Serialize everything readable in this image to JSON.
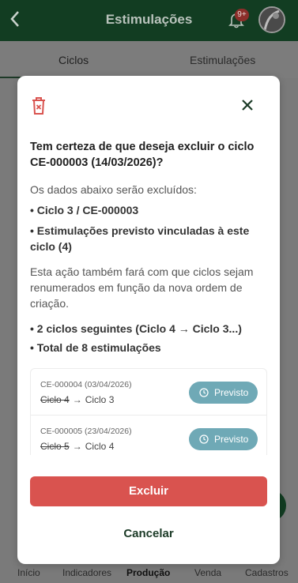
{
  "header": {
    "back_icon": "chevron-left-icon",
    "title": "Estimulações",
    "notification_badge": "9+",
    "bell_icon": "bell-icon"
  },
  "tabs": [
    {
      "label": "Ciclos",
      "active": true
    },
    {
      "label": "Estimulações",
      "active": false
    }
  ],
  "bottom_nav": [
    {
      "label": "Início"
    },
    {
      "label": "Indicadores"
    },
    {
      "label": "Produção",
      "active": true
    },
    {
      "label": "Venda"
    },
    {
      "label": "Cadastros"
    }
  ],
  "modal": {
    "trash_icon": "trash-icon",
    "close_icon": "close-icon",
    "heading": "Tem certeza de que deseja excluir o ciclo CE-000003 (14/03/2026)?",
    "intro": "Os dados abaixo serão excluídos:",
    "bullet_cycle": "• Ciclo 3 / CE-000003",
    "bullet_stims": "• Estimulações previsto vinculadas à este ciclo (4)",
    "renumber_text": "Esta ação também fará com que ciclos sejam renumerados em função da nova ordem de criação.",
    "bullet_following": "• 2 ciclos seguintes (Ciclo 4 → Ciclo 3...)",
    "bullet_total": "• Total de 8 estimulações",
    "items": [
      {
        "code": "CE-000004 (03/04/2026)",
        "old": "Ciclo 4",
        "arrow": "→",
        "new": "Ciclo 3",
        "status": "Previsto"
      },
      {
        "code": "CE-000005 (23/04/2026)",
        "old": "Ciclo 5",
        "arrow": "→",
        "new": "Ciclo 4",
        "status": "Previsto"
      }
    ],
    "delete_label": "Excluir",
    "cancel_label": "Cancelar"
  },
  "colors": {
    "header_bg": "#123d22",
    "delete_bg": "#d9534f",
    "status_pill": "#6fa9b6",
    "cancel_text": "#1b3a26"
  }
}
